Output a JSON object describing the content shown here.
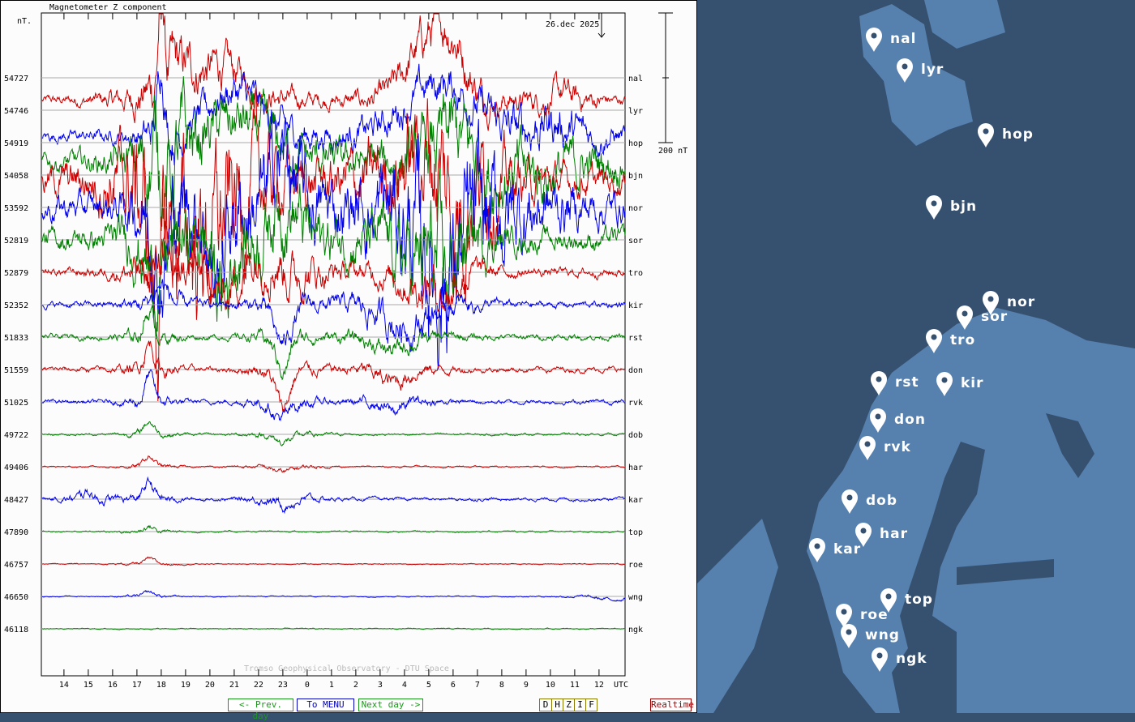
{
  "chart_data": {
    "type": "line",
    "title": "Magnetometer Z component",
    "ylabel": "nT.",
    "date_label": "26.dec 2025",
    "scale_label": "200 nT",
    "scale_nT": 200,
    "credit": "Tromso Geophysical Observatory - DTU Space",
    "x_unit": "UTC",
    "x_tick_labels": [
      "14",
      "15",
      "16",
      "17",
      "18",
      "19",
      "20",
      "21",
      "22",
      "23",
      "0",
      "1",
      "2",
      "3",
      "4",
      "5",
      "6",
      "7",
      "8",
      "9",
      "10",
      "11",
      "12"
    ],
    "x_range_hours": [
      13.07,
      37.07
    ],
    "grid": "horizontal baselines",
    "series": [
      {
        "name": "nal",
        "baseline": "54727",
        "color": "#cc0000",
        "offset": -35,
        "noise": 8,
        "features": [
          [
            18,
            140,
            0.15
          ],
          [
            18.5,
            40,
            1
          ],
          [
            20.5,
            50,
            1.5
          ],
          [
            29,
            90,
            1.2
          ],
          [
            30,
            60,
            0.8
          ],
          [
            34.5,
            10,
            0.5
          ]
        ]
      },
      {
        "name": "lyr",
        "baseline": "54746",
        "color": "#0000ee",
        "offset": -40,
        "noise": 10,
        "features": [
          [
            18,
            110,
            0.2
          ],
          [
            21,
            70,
            1.5
          ],
          [
            29.5,
            80,
            2
          ],
          [
            34,
            20,
            1
          ]
        ]
      },
      {
        "name": "hop",
        "baseline": "54919",
        "color": "#008000",
        "offset": -30,
        "noise": 15,
        "features": [
          [
            18,
            60,
            0.3
          ],
          [
            18.2,
            -80,
            0.3
          ],
          [
            21,
            60,
            2
          ],
          [
            30,
            40,
            1
          ],
          [
            33,
            -20,
            2
          ]
        ]
      },
      {
        "name": "bjn",
        "baseline": "54058",
        "color": "#cc0000",
        "offset": -10,
        "noise": 25,
        "features": [
          [
            17.8,
            -150,
            0.4
          ],
          [
            19,
            -80,
            1.5
          ],
          [
            20.5,
            -40,
            1
          ],
          [
            29,
            50,
            1.5
          ],
          [
            30,
            -80,
            0.5
          ]
        ]
      },
      {
        "name": "nor",
        "baseline": "53592",
        "color": "#0000ee",
        "offset": 0,
        "noise": 25,
        "features": [
          [
            18,
            -100,
            0.4
          ],
          [
            20.3,
            -120,
            0.4
          ],
          [
            23,
            80,
            0.6
          ],
          [
            29.5,
            -60,
            1
          ],
          [
            30,
            -40,
            2
          ]
        ]
      },
      {
        "name": "sor",
        "baseline": "52819",
        "color": "#008000",
        "offset": 0,
        "noise": 20,
        "features": [
          [
            17.8,
            -70,
            0.5
          ],
          [
            20.5,
            -90,
            0.4
          ],
          [
            23,
            60,
            0.8
          ],
          [
            28.5,
            -40,
            1
          ],
          [
            29.7,
            -60,
            0.4
          ]
        ]
      },
      {
        "name": "tro",
        "baseline": "52879",
        "color": "#cc0000",
        "offset": 0,
        "noise": 8,
        "features": [
          [
            17.8,
            -20,
            0.5
          ],
          [
            18,
            50,
            0.3
          ],
          [
            20.5,
            -40,
            0.5
          ],
          [
            22.5,
            30,
            1
          ],
          [
            23.3,
            -15,
            0.5
          ],
          [
            28.5,
            -20,
            1
          ],
          [
            29.7,
            -30,
            0.4
          ]
        ]
      },
      {
        "name": "kir",
        "baseline": "52352",
        "color": "#0000ee",
        "offset": 0,
        "noise": 6,
        "features": [
          [
            18,
            30,
            0.4
          ],
          [
            23,
            -60,
            0.5
          ],
          [
            27.5,
            -20,
            1
          ],
          [
            28.5,
            -20,
            1
          ]
        ]
      },
      {
        "name": "rst",
        "baseline": "51833",
        "color": "#008000",
        "offset": 0,
        "noise": 5,
        "features": [
          [
            17.5,
            40,
            0.3
          ],
          [
            23,
            -50,
            0.4
          ],
          [
            27.5,
            -20,
            1
          ]
        ]
      },
      {
        "name": "don",
        "baseline": "51559",
        "color": "#cc0000",
        "offset": 0,
        "noise": 5,
        "features": [
          [
            17.5,
            40,
            0.3
          ],
          [
            23,
            -60,
            0.4
          ],
          [
            27.5,
            -20,
            0.7
          ]
        ]
      },
      {
        "name": "rvk",
        "baseline": "51025",
        "color": "#0000ee",
        "offset": 0,
        "noise": 4,
        "features": [
          [
            17.5,
            40,
            0.25
          ],
          [
            23,
            -25,
            0.5
          ],
          [
            27.5,
            -15,
            0.5
          ]
        ]
      },
      {
        "name": "dob",
        "baseline": "49722",
        "color": "#008000",
        "offset": 0,
        "noise": 2,
        "features": [
          [
            17.5,
            20,
            0.3
          ],
          [
            23,
            -12,
            0.5
          ]
        ]
      },
      {
        "name": "har",
        "baseline": "49406",
        "color": "#cc0000",
        "offset": 0,
        "noise": 1.5,
        "features": [
          [
            17.5,
            15,
            0.3
          ],
          [
            23,
            -8,
            0.5
          ]
        ]
      },
      {
        "name": "kar",
        "baseline": "48427",
        "color": "#0000ee",
        "offset": 0,
        "noise": 3,
        "features": [
          [
            15,
            12,
            0.3
          ],
          [
            17.5,
            25,
            0.3
          ],
          [
            23,
            -8,
            0.5
          ]
        ]
      },
      {
        "name": "top",
        "baseline": "47890",
        "color": "#008000",
        "offset": 0,
        "noise": 1.5,
        "features": [
          [
            17.5,
            8,
            0.3
          ]
        ]
      },
      {
        "name": "roe",
        "baseline": "46757",
        "color": "#cc0000",
        "offset": 0,
        "noise": 1,
        "features": [
          [
            17.5,
            7,
            0.3
          ]
        ]
      },
      {
        "name": "wng",
        "baseline": "46650",
        "color": "#0000ee",
        "offset": 0,
        "noise": 1,
        "features": [
          [
            17.5,
            6,
            0.3
          ],
          [
            36.5,
            -5,
            0.8
          ]
        ]
      },
      {
        "name": "ngk",
        "baseline": "46118",
        "color": "#008000",
        "offset": 0,
        "noise": 1,
        "features": []
      }
    ]
  },
  "nav": {
    "prev": "<- Prev. day",
    "menu": "To MENU",
    "next": "Next day ->",
    "realtime": "Realtime"
  },
  "components": [
    "D",
    "H",
    "Z",
    "I",
    "F"
  ],
  "map": {
    "ocean_color": "#36506f",
    "land_color": "#5680ad",
    "stations": [
      "nal",
      "lyr",
      "hop",
      "bjn",
      "nor",
      "sor",
      "tro",
      "rst",
      "kir",
      "don",
      "rvk",
      "dob",
      "har",
      "kar",
      "top",
      "roe",
      "wng",
      "ngk"
    ]
  }
}
